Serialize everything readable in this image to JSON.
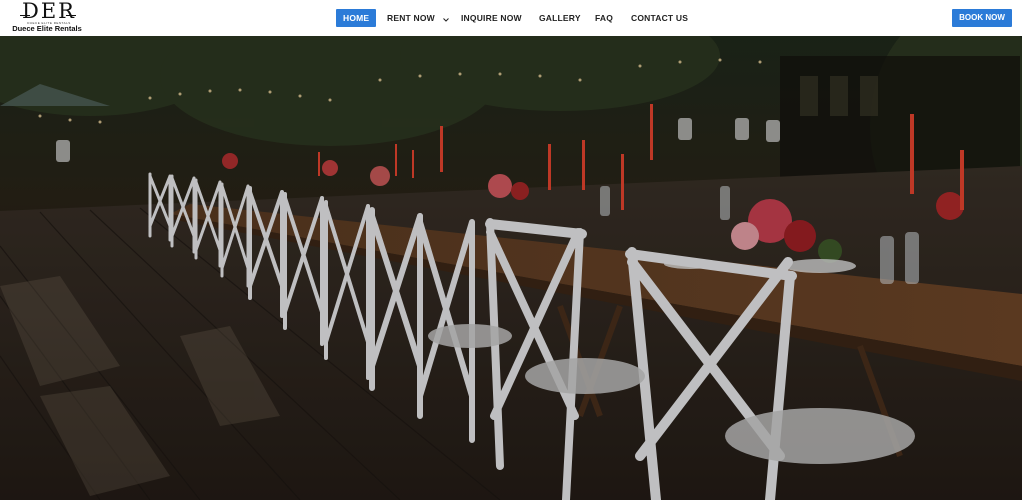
{
  "brand": {
    "logo_mark": "DER",
    "logo_tagline": "DUECE ELITE RENTALS",
    "name": "Duece Elite Rentals"
  },
  "nav": {
    "items": [
      {
        "label": "HOME",
        "active": true
      },
      {
        "label": "RENT NOW",
        "has_dropdown": true
      },
      {
        "label": "INQUIRE NOW"
      },
      {
        "label": "GALLERY"
      },
      {
        "label": "FAQ"
      },
      {
        "label": "CONTACT US"
      }
    ]
  },
  "cta": {
    "book_label": "BOOK NOW"
  },
  "colors": {
    "accent": "#2b7bd8",
    "header_bg": "#ffffff",
    "nav_text": "#222222"
  },
  "hero": {
    "image_subject": "outdoor-banquet-table-with-white-crossback-chairs"
  }
}
